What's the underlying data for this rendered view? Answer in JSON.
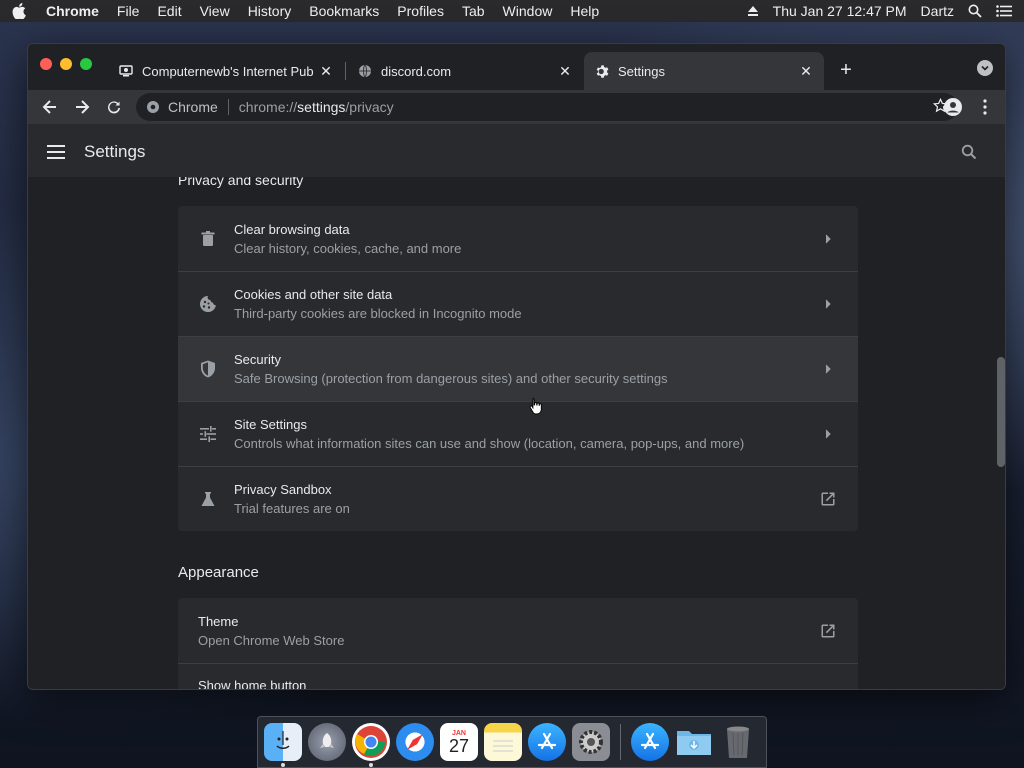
{
  "menubar": {
    "app": "Chrome",
    "items": [
      "File",
      "Edit",
      "View",
      "History",
      "Bookmarks",
      "Profiles",
      "Tab",
      "Window",
      "Help"
    ],
    "clock": "Thu Jan 27  12:47 PM",
    "user": "Dartz"
  },
  "tabs": [
    {
      "title": "Computernewb's Internet Pub",
      "favicon": "computer-icon"
    },
    {
      "title": "discord.com",
      "favicon": "globe-icon"
    },
    {
      "title": "Settings",
      "favicon": "gear-icon",
      "active": true
    }
  ],
  "omnibox": {
    "chip": "Chrome",
    "url_prefix": "chrome://",
    "url_host": "settings",
    "url_path": "/privacy"
  },
  "settings": {
    "header_title": "Settings",
    "privacy_section_title": "Privacy and security",
    "privacy_rows": [
      {
        "primary": "Clear browsing data",
        "secondary": "Clear history, cookies, cache, and more",
        "icon": "trash-icon",
        "trail": "chevron-right-icon"
      },
      {
        "primary": "Cookies and other site data",
        "secondary": "Third-party cookies are blocked in Incognito mode",
        "icon": "cookie-icon",
        "trail": "chevron-right-icon"
      },
      {
        "primary": "Security",
        "secondary": "Safe Browsing (protection from dangerous sites) and other security settings",
        "icon": "shield-icon",
        "trail": "chevron-right-icon"
      },
      {
        "primary": "Site Settings",
        "secondary": "Controls what information sites can use and show (location, camera, pop-ups, and more)",
        "icon": "tune-icon",
        "trail": "chevron-right-icon"
      },
      {
        "primary": "Privacy Sandbox",
        "secondary": "Trial features are on",
        "icon": "flask-icon",
        "trail": "external-link-icon"
      }
    ],
    "appearance_section_title": "Appearance",
    "appearance_rows": [
      {
        "primary": "Theme",
        "secondary": "Open Chrome Web Store",
        "trail": "external-link-icon"
      },
      {
        "primary": "Show home button",
        "secondary": "",
        "trail": "toggle"
      }
    ]
  },
  "dock": {
    "items": [
      "finder-icon",
      "launchpad-icon",
      "chrome-icon",
      "safari-icon",
      "calendar-icon",
      "notes-icon",
      "app-store-icon",
      "system-preferences-icon",
      "app-store-icon",
      "downloads-folder-icon",
      "trash-icon"
    ],
    "calendar": {
      "month": "JAN",
      "day": "27"
    }
  },
  "colors": {
    "background": "#202124",
    "card": "#292a2d",
    "text_primary": "#e8eaed",
    "text_secondary": "#9aa0a6"
  }
}
